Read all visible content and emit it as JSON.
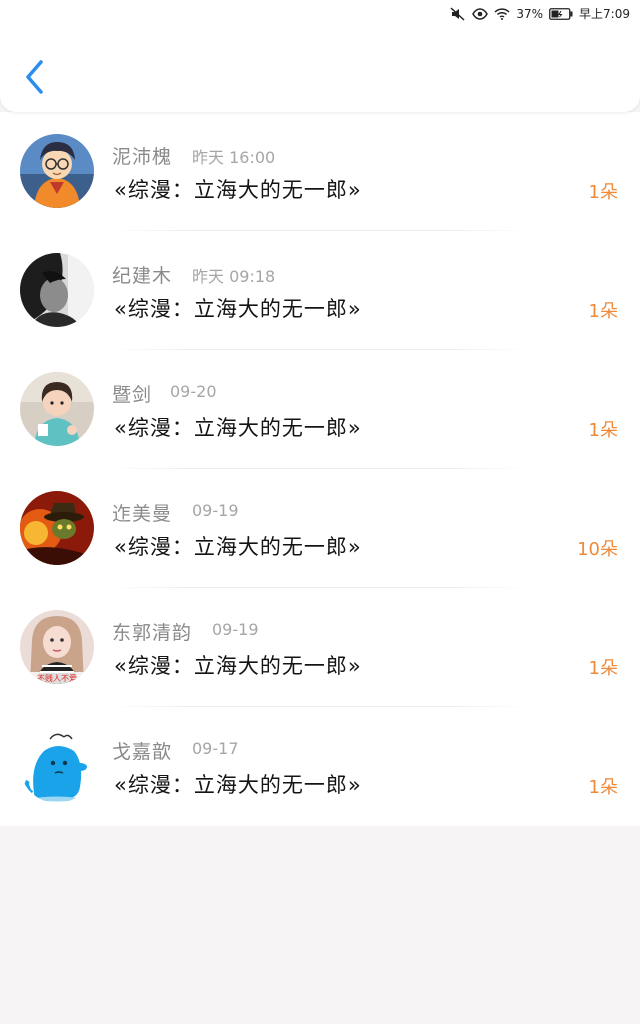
{
  "status_bar": {
    "battery": "37%",
    "time": "早上7:09"
  },
  "header": {
    "back_icon": "chevron-left-icon"
  },
  "list": {
    "items": [
      {
        "name": "泥沛槐",
        "time": "昨天 16:00",
        "title": "«综漫：立海大的无一郎»",
        "count": "1朵"
      },
      {
        "name": "纪建木",
        "time": "昨天 09:18",
        "title": "«综漫：立海大的无一郎»",
        "count": "1朵"
      },
      {
        "name": "暨剑",
        "time": "09-20",
        "title": "«综漫：立海大的无一郎»",
        "count": "1朵"
      },
      {
        "name": "迮美曼",
        "time": "09-19",
        "title": "«综漫：立海大的无一郎»",
        "count": "10朵"
      },
      {
        "name": "东郭清韵",
        "time": "09-19",
        "title": "«综漫：立海大的无一郎»",
        "count": "1朵"
      },
      {
        "name": "戈嘉歆",
        "time": "09-17",
        "title": "«综漫：立海大的无一郎»",
        "count": "1朵"
      }
    ]
  },
  "avatar_overlays": {
    "item_5_caption": "不贱人不爱"
  },
  "colors": {
    "accent": "#2a8ef0",
    "count": "#ef8a3a",
    "name": "#8a8a8a",
    "title": "#141414"
  }
}
